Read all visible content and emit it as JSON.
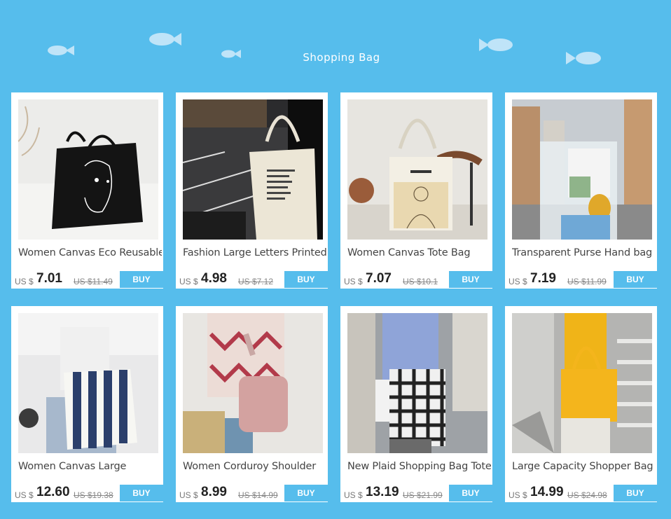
{
  "header": {
    "title": "Shopping Bag"
  },
  "colors": {
    "background": "#56bdec",
    "buy_button": "#56bdec",
    "fish": "#bfe4f8"
  },
  "products": [
    {
      "name": "Women Canvas Eco Reusable",
      "currency": "US $",
      "price": "7.01",
      "old_price": "US $11.49",
      "buy": "BUY"
    },
    {
      "name": "Fashion Large Letters Printed",
      "currency": "US $",
      "price": "4.98",
      "old_price": "US $7.12",
      "buy": "BUY"
    },
    {
      "name": "Women Canvas Tote Bag",
      "currency": "US $",
      "price": "7.07",
      "old_price": "US $10.1",
      "buy": "BUY"
    },
    {
      "name": "Transparent Purse Hand bag",
      "currency": "US $",
      "price": "7.19",
      "old_price": "US $11.99",
      "buy": "BUY"
    },
    {
      "name": "Women Canvas Large",
      "currency": "US $",
      "price": "12.60",
      "old_price": "US $19.38",
      "buy": "BUY"
    },
    {
      "name": "Women Corduroy Shoulder",
      "currency": "US $",
      "price": "8.99",
      "old_price": "US $14.99",
      "buy": "BUY"
    },
    {
      "name": "New Plaid Shopping Bag Tote",
      "currency": "US $",
      "price": "13.19",
      "old_price": "US $21.99",
      "buy": "BUY"
    },
    {
      "name": "Large Capacity Shopper Bag",
      "currency": "US $",
      "price": "14.99",
      "old_price": "US $24.98",
      "buy": "BUY"
    }
  ]
}
